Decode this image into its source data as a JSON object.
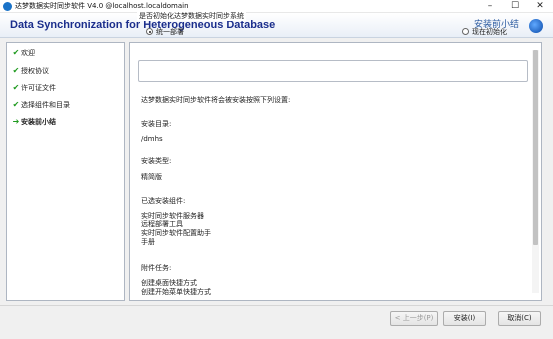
{
  "window": {
    "title": "达梦数据实时同步软件 V4.0 @localhost.localdomain",
    "minimize_glyph": "–",
    "maximize_glyph": "☐",
    "close_glyph": "✕"
  },
  "header": {
    "title": "Data Synchronization for Heterogeneous Database",
    "step_label": "安装前小结"
  },
  "sidebar": {
    "items": [
      {
        "label": "欢迎",
        "state": "done",
        "icon": "check-icon"
      },
      {
        "label": "授权协议",
        "state": "done",
        "icon": "check-icon"
      },
      {
        "label": "许可证文件",
        "state": "done",
        "icon": "check-icon"
      },
      {
        "label": "选择组件和目录",
        "state": "done",
        "icon": "check-icon"
      },
      {
        "label": "安装前小结",
        "state": "current",
        "icon": "arrow-right-icon"
      }
    ],
    "check_glyph": "✔",
    "arrow_glyph": "➔"
  },
  "content": {
    "init_group_legend": "是否初始化达梦数据实时同步系统",
    "radio_unified": "统一部署",
    "radio_init_now": "现在初始化",
    "selected_option": "统一部署",
    "intro": "达梦数据实时同步软件将会被安装按照下列设置:",
    "dir_heading": "安装目录:",
    "dir_value": "/dmhs",
    "type_heading": "安装类型:",
    "type_value": "精简版",
    "components_heading": "已选安装组件:",
    "components": [
      "实时同步软件服务器",
      "远程部署工具",
      "实时同步软件配置助手",
      "手册"
    ],
    "tasks_heading": "附件任务:",
    "tasks": [
      "创建桌面快捷方式",
      "创建开始菜单快捷方式"
    ]
  },
  "footer": {
    "back_label": "< 上一步(P)",
    "install_label": "安装(I)",
    "cancel_label": "取消(C)"
  },
  "colors": {
    "header_title": "#1b2e8c",
    "step_label": "#2a5aa0",
    "check_green": "#1e9a1e"
  }
}
